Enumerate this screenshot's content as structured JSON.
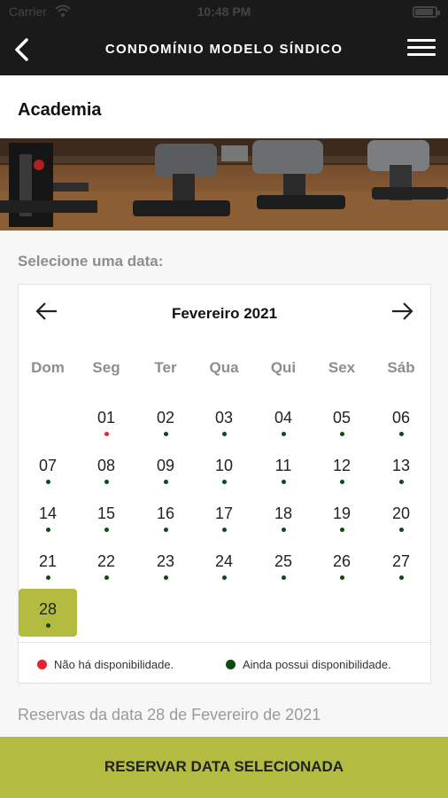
{
  "status_bar": {
    "carrier": "Carrier",
    "wifi_icon": "wifi-icon",
    "time": "10:48 PM",
    "battery_icon": "battery-icon"
  },
  "header": {
    "back_icon": "chevron-left-icon",
    "title": "CONDOMÍNIO MODELO SÍNDICO",
    "menu_icon": "hamburger-menu-icon"
  },
  "page": {
    "title": "Academia",
    "banner_image": "gym-equipment-photo"
  },
  "calendar": {
    "prompt": "Selecione uma data:",
    "month_label": "Fevereiro 2021",
    "prev_icon": "arrow-left-icon",
    "next_icon": "arrow-right-icon",
    "weekdays": [
      "Dom",
      "Seg",
      "Ter",
      "Qua",
      "Qui",
      "Sex",
      "Sáb"
    ],
    "days": [
      {
        "label": "01",
        "availability": "unavailable"
      },
      {
        "label": "02",
        "availability": "available"
      },
      {
        "label": "03",
        "availability": "available"
      },
      {
        "label": "04",
        "availability": "available"
      },
      {
        "label": "05",
        "availability": "available"
      },
      {
        "label": "06",
        "availability": "available"
      },
      {
        "label": "07",
        "availability": "available"
      },
      {
        "label": "08",
        "availability": "available"
      },
      {
        "label": "09",
        "availability": "available"
      },
      {
        "label": "10",
        "availability": "available"
      },
      {
        "label": "11",
        "availability": "available"
      },
      {
        "label": "12",
        "availability": "available"
      },
      {
        "label": "13",
        "availability": "available"
      },
      {
        "label": "14",
        "availability": "available"
      },
      {
        "label": "15",
        "availability": "available"
      },
      {
        "label": "16",
        "availability": "available"
      },
      {
        "label": "17",
        "availability": "available"
      },
      {
        "label": "18",
        "availability": "available"
      },
      {
        "label": "19",
        "availability": "available"
      },
      {
        "label": "20",
        "availability": "available"
      },
      {
        "label": "21",
        "availability": "available"
      },
      {
        "label": "22",
        "availability": "available"
      },
      {
        "label": "23",
        "availability": "available"
      },
      {
        "label": "24",
        "availability": "available"
      },
      {
        "label": "25",
        "availability": "available"
      },
      {
        "label": "26",
        "availability": "available"
      },
      {
        "label": "27",
        "availability": "available"
      },
      {
        "label": "28",
        "availability": "available",
        "selected": true
      }
    ],
    "legend": {
      "unavailable": "Não há disponibilidade.",
      "available": "Ainda possui disponibilidade."
    },
    "colors": {
      "unavailable": "#e52433",
      "available": "#0c4a16",
      "selected": "#b4bb41"
    }
  },
  "reservations": {
    "label": "Reservas da data 28 de Fevereiro de 2021"
  },
  "footer": {
    "button_label": "RESERVAR DATA SELECIONADA",
    "accent": "#b4bb41"
  }
}
